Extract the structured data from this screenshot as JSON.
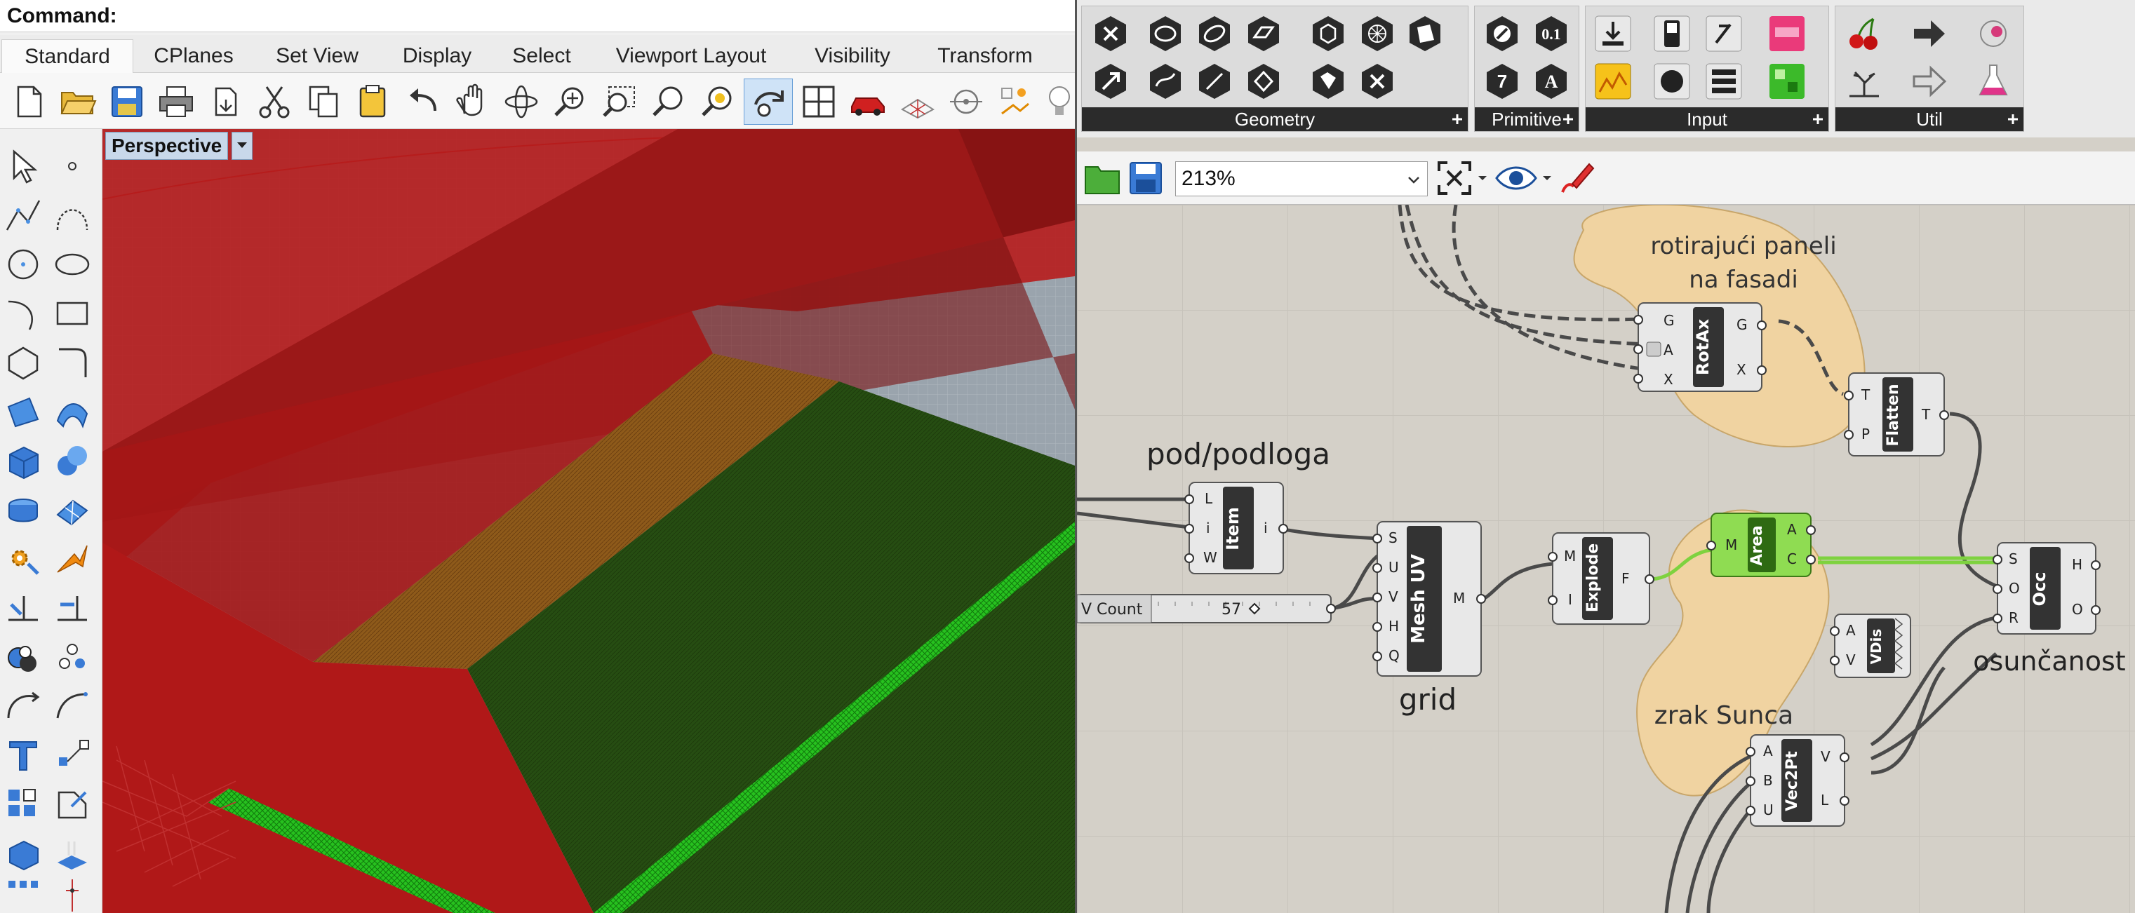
{
  "rhino": {
    "command_label": "Command:",
    "tabs": [
      {
        "label": "Standard",
        "active": true
      },
      {
        "label": "CPlanes"
      },
      {
        "label": "Set View"
      },
      {
        "label": "Display"
      },
      {
        "label": "Select"
      },
      {
        "label": "Viewport Layout"
      },
      {
        "label": "Visibility"
      },
      {
        "label": "Transform"
      }
    ],
    "toolbar_icons": [
      "new-file-icon",
      "open-folder-icon",
      "save-icon",
      "print-icon",
      "import-icon",
      "cut-icon",
      "copy-icon",
      "paste-icon",
      "undo-icon",
      "pan-hand-icon",
      "rotate-view-icon",
      "zoom-icon",
      "zoom-window-icon",
      "zoom-extents-icon",
      "zoom-selected-icon",
      "rotate-camera-icon",
      "four-viewports-icon",
      "car-render-icon",
      "grid-options-icon",
      "osnap-icon",
      "light-icon"
    ],
    "side_icons": [
      "select-arrow-icon",
      "point-icon",
      "polyline-icon",
      "curve-icon",
      "circle-icon",
      "ellipse-icon",
      "arc-icon",
      "rectangle-icon",
      "polygon-icon",
      "fillet-icon",
      "surface-icon",
      "sweep-icon",
      "box-icon",
      "sphere-icon",
      "cylinder-icon",
      "mesh-icon",
      "gear-tools-icon",
      "split-icon",
      "trim-icon",
      "extend-icon",
      "boolean-icon",
      "points-icon",
      "bend-icon",
      "transform-icon",
      "text-icon",
      "dimension-icon",
      "group-icon",
      "block-icon",
      "display-icon",
      "light-icon"
    ],
    "viewport": {
      "title": "Perspective",
      "colors": {
        "background": "#9aa4ad",
        "red": "#9b1818",
        "green": "#264d12",
        "mesh_green": "#27c11f"
      }
    }
  },
  "grasshopper": {
    "panels": [
      {
        "label": "Geometry"
      },
      {
        "label": "Primitive"
      },
      {
        "label": "Input"
      },
      {
        "label": "Util"
      }
    ],
    "zoom": "213%",
    "groups": [
      {
        "label": "rotirajući paneli\nna fasadi",
        "label_line1": "rotirajući paneli",
        "label_line2": "na fasadi",
        "color": "#f0d3a1"
      },
      {
        "label": "zrak Sunca",
        "color": "#f0d3a1"
      }
    ],
    "text_labels": {
      "pod": "pod/podloga",
      "grid": "grid",
      "osuncanost": "osunčanost"
    },
    "components": [
      {
        "name": "RotAx",
        "inputs": [
          "G",
          "A",
          "X"
        ],
        "outputs": [
          "G",
          "X"
        ]
      },
      {
        "name": "Flatten",
        "inputs": [
          "T",
          "P"
        ],
        "outputs": [
          "T"
        ]
      },
      {
        "name": "Item",
        "inputs": [
          "L",
          "i",
          "W"
        ],
        "outputs": [
          "i"
        ]
      },
      {
        "name": "Mesh UV",
        "inputs": [
          "S",
          "U",
          "V",
          "H",
          "Q"
        ],
        "outputs": [
          "M"
        ]
      },
      {
        "name": "Explode",
        "inputs": [
          "M",
          "I"
        ],
        "outputs": [
          "F"
        ]
      },
      {
        "name": "Area",
        "inputs": [
          "M"
        ],
        "outputs": [
          "A",
          "C"
        ]
      },
      {
        "name": "Occ",
        "inputs": [
          "S",
          "O",
          "R"
        ],
        "outputs": [
          "H",
          "O"
        ]
      },
      {
        "name": "VDis",
        "inputs": [
          "A",
          "V"
        ],
        "outputs": []
      },
      {
        "name": "Vec2Pt",
        "inputs": [
          "A",
          "B",
          "U"
        ],
        "outputs": [
          "V",
          "L"
        ]
      }
    ],
    "slider": {
      "label": "V Count",
      "value": "57"
    }
  }
}
